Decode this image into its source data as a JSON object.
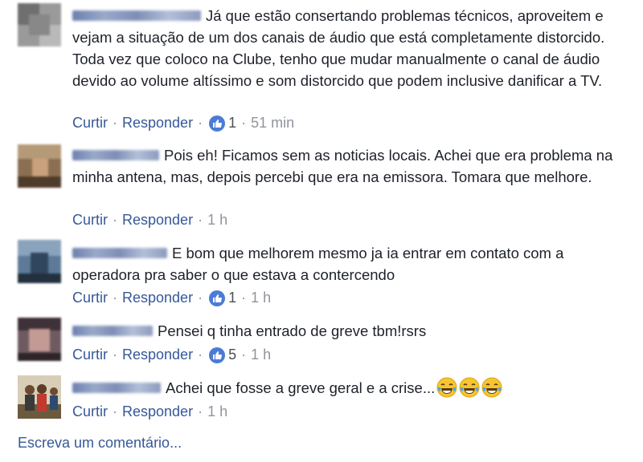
{
  "comments": [
    {
      "text": "Já que estão consertando problemas técnicos, aproveitem e vejam a situação de um dos canais de áudio que está completamente distorcido. Toda vez que coloco na Clube, tenho que mudar manualmente o canal de áudio devido ao volume altíssimo e som distorcido que podem inclusive danificar a TV.",
      "like_label": "Curtir",
      "reply_label": "Responder",
      "reactions": "1",
      "time": "51 min"
    },
    {
      "text": "Pois eh! Ficamos sem as noticias locais. Achei que era problema na minha antena, mas, depois percebi que era na emissora. Tomara que melhore.",
      "like_label": "Curtir",
      "reply_label": "Responder",
      "time": "1 h"
    },
    {
      "text": "E bom que melhorem mesmo ja ia entrar em contato com a operadora pra saber o que estava a contercendo",
      "like_label": "Curtir",
      "reply_label": "Responder",
      "reactions": "1",
      "time": "1 h"
    },
    {
      "text": "Pensei q tinha entrado de greve tbm!rsrs",
      "like_label": "Curtir",
      "reply_label": "Responder",
      "reactions": "5",
      "time": "1 h"
    },
    {
      "text": "Achei que fosse a greve geral e a crise...",
      "like_label": "Curtir",
      "reply_label": "Responder",
      "time": "1 h",
      "emojis": [
        "laughing-tears-emoji",
        "laughing-tears-emoji",
        "laughing-tears-emoji"
      ]
    }
  ],
  "write_comment_placeholder": "Escreva um comentário...",
  "colors": {
    "link": "#365899",
    "meta": "#90949c",
    "text": "#1d2129",
    "like_badge": "#4b7bd6"
  },
  "icons": [
    "like-thumb-icon",
    "laughing-tears-emoji",
    "avatar"
  ]
}
